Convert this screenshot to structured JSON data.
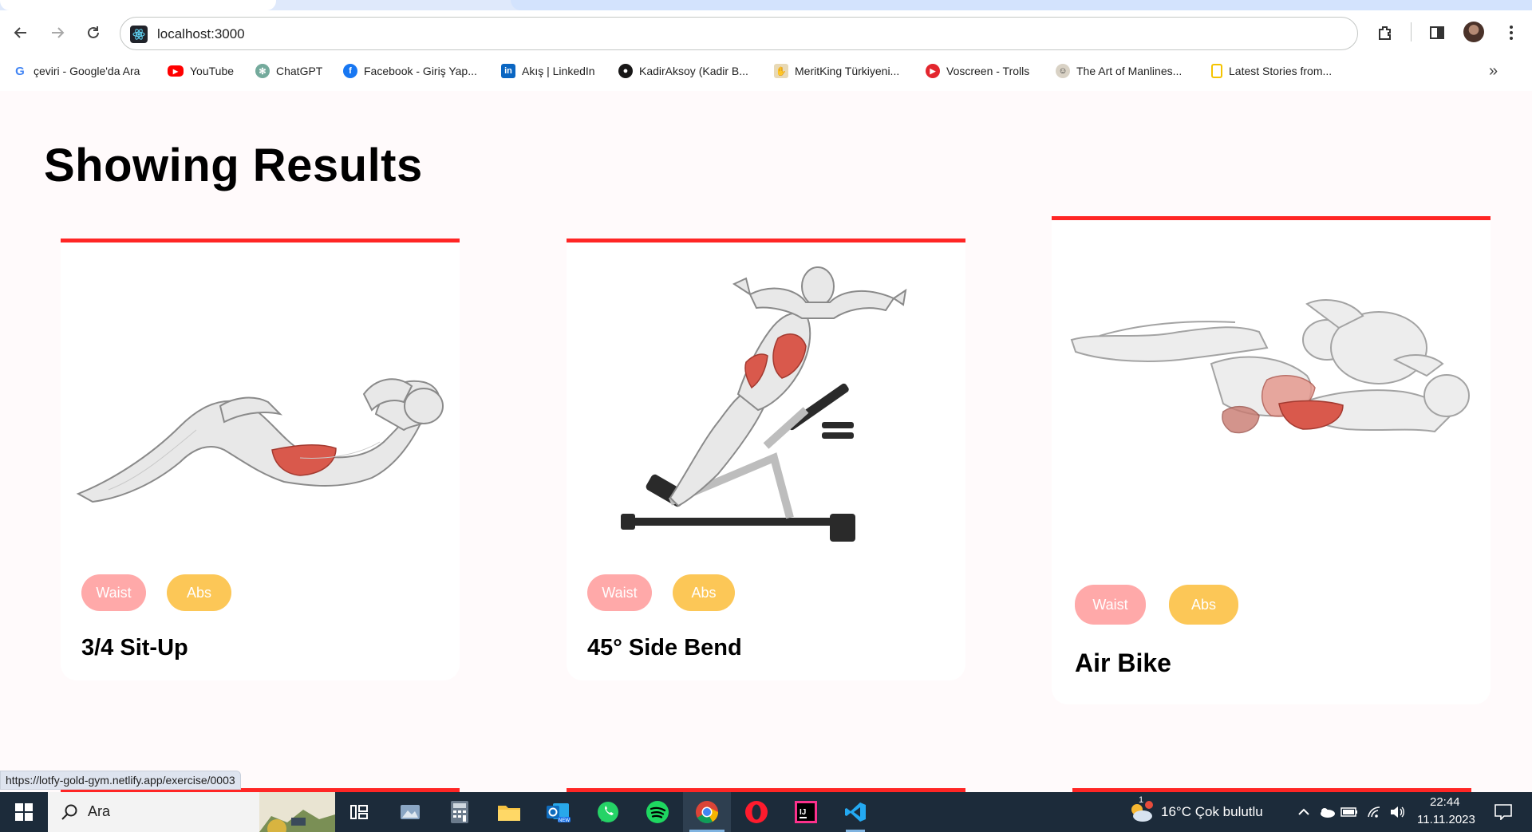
{
  "browser": {
    "url": "localhost:3000",
    "bookmarks": [
      {
        "label": "çeviri - Google'da Ara",
        "icon": "google-icon"
      },
      {
        "label": "YouTube",
        "icon": "youtube-icon"
      },
      {
        "label": "ChatGPT",
        "icon": "chatgpt-icon"
      },
      {
        "label": "Facebook - Giriş Yap...",
        "icon": "facebook-icon"
      },
      {
        "label": "Akış | LinkedIn",
        "icon": "linkedin-icon"
      },
      {
        "label": "KadirAksoy (Kadir B...",
        "icon": "github-icon"
      },
      {
        "label": "MeritKing Türkiyeni...",
        "icon": "meritking-icon"
      },
      {
        "label": "Voscreen - Trolls",
        "icon": "voscreen-icon"
      },
      {
        "label": "The Art of Manlines...",
        "icon": "artofmanliness-icon"
      },
      {
        "label": "Latest Stories from...",
        "icon": "stories-icon"
      }
    ],
    "status_url": "https://lotfy-gold-gym.netlify.app/exercise/0003"
  },
  "page": {
    "title": "Showing Results",
    "cards": [
      {
        "name": "3/4 Sit-Up",
        "tags": [
          "Waist",
          "Abs"
        ],
        "image": "sit-up-illustration"
      },
      {
        "name": "45° Side Bend",
        "tags": [
          "Waist",
          "Abs"
        ],
        "image": "side-bend-illustration"
      },
      {
        "name": "Air Bike",
        "tags": [
          "Waist",
          "Abs"
        ],
        "image": "air-bike-illustration"
      }
    ]
  },
  "taskbar": {
    "search_placeholder": "Ara",
    "weather": "16°C  Çok bulutlu",
    "weather_badge": "1",
    "time": "22:44",
    "date": "11.11.2023"
  },
  "colors": {
    "accent_red": "#ff2625",
    "tag_waist": "#ffa9a9",
    "tag_abs": "#fcc757",
    "page_bg": "#fffafb",
    "taskbar_bg": "#1c2b3a"
  }
}
